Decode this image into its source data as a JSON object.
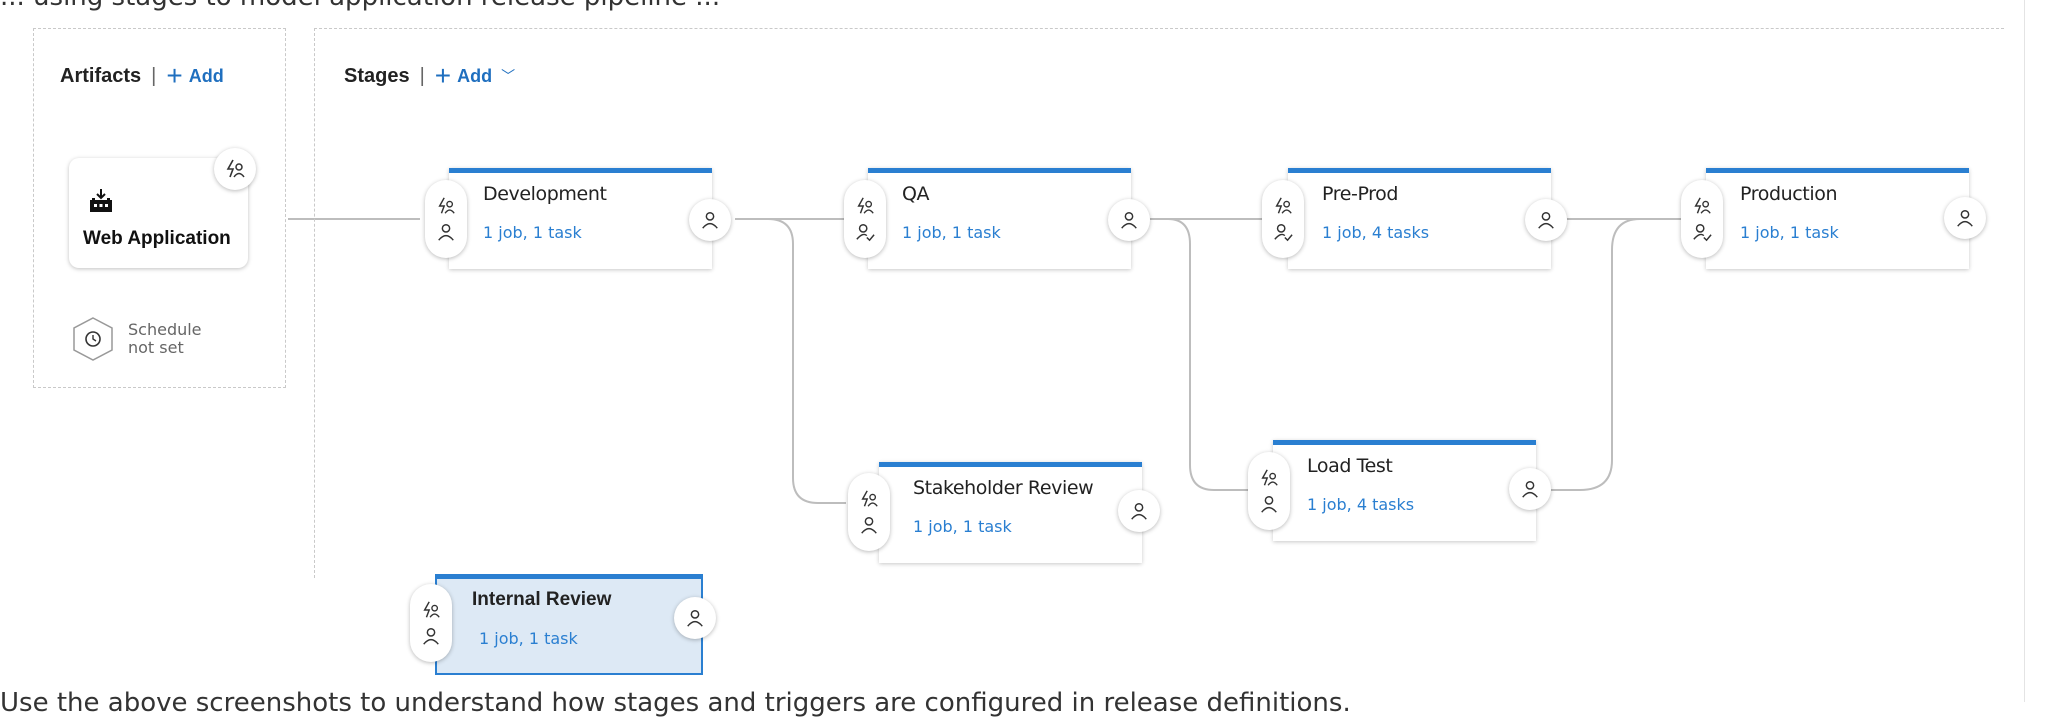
{
  "top_text": "... using stages to model application release pipeline ...",
  "bottom_text": "Use the above screenshots to understand how stages and triggers are configured in release definitions.",
  "artifacts": {
    "header": "Artifacts",
    "separator": "|",
    "add_label": "Add",
    "artifact_name": "Web Application",
    "schedule_line1": "Schedule",
    "schedule_line2": "not set"
  },
  "stages": {
    "header": "Stages",
    "separator": "|",
    "add_label": "Add",
    "items": [
      {
        "name": "Development",
        "summary": "1 job, 1 task"
      },
      {
        "name": "QA",
        "summary": "1 job, 1 task"
      },
      {
        "name": "Pre-Prod",
        "summary": "1 job, 4 tasks"
      },
      {
        "name": "Production",
        "summary": "1 job, 1 task"
      },
      {
        "name": "Stakeholder Review",
        "summary": "1 job, 1 task"
      },
      {
        "name": "Load Test",
        "summary": "1 job, 4 tasks"
      },
      {
        "name": "Internal Review",
        "summary": "1 job, 1 task",
        "selected": true
      }
    ]
  },
  "icons": {
    "trigger": "lightning-person-icon",
    "approver": "person-icon",
    "approval_gate": "person-check-icon",
    "build": "build-icon",
    "schedule": "clock-hexagon-icon"
  },
  "colors": {
    "accent": "#2a7fd1",
    "selected_bg": "#dde9f5"
  }
}
